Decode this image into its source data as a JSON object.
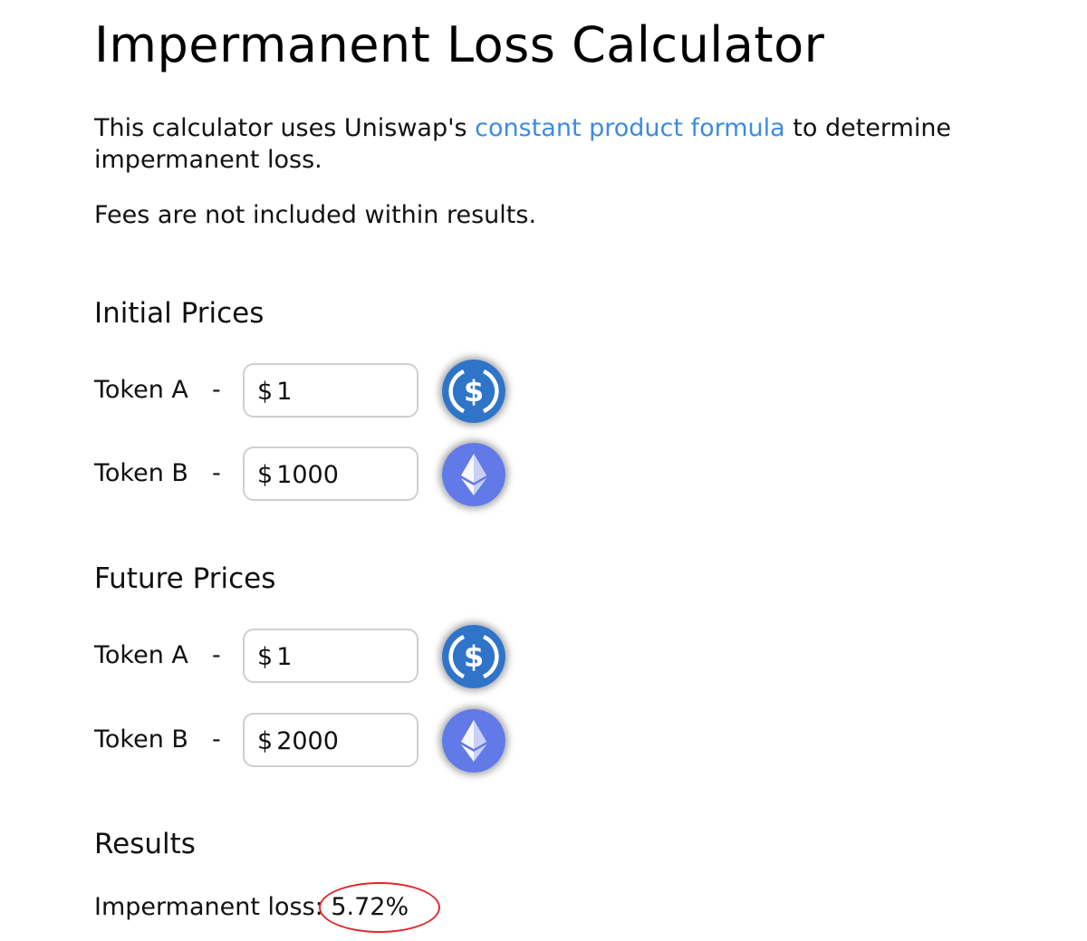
{
  "title": "Impermanent Loss Calculator",
  "intro": {
    "before": "This calculator uses Uniswap's ",
    "link": "constant product formula",
    "after": " to determine impermanent loss."
  },
  "fees_note": "Fees are not included within results.",
  "initial": {
    "heading": "Initial Prices",
    "token_a": {
      "label": "Token A",
      "dash": "-",
      "currency": "$",
      "value": "1",
      "icon": "usdc-icon"
    },
    "token_b": {
      "label": "Token B",
      "dash": "-",
      "currency": "$",
      "value": "1000",
      "icon": "ethereum-icon"
    }
  },
  "future": {
    "heading": "Future Prices",
    "token_a": {
      "label": "Token A",
      "dash": "-",
      "currency": "$",
      "value": "1",
      "icon": "usdc-icon"
    },
    "token_b": {
      "label": "Token B",
      "dash": "-",
      "currency": "$",
      "value": "2000",
      "icon": "ethereum-icon"
    }
  },
  "results": {
    "heading": "Results",
    "label": "Impermanent loss: ",
    "value": "5.72%"
  },
  "colors": {
    "link": "#3d8be0",
    "usdc": "#2f74c8",
    "eth": "#6279e8",
    "highlight": "#e0282d"
  }
}
